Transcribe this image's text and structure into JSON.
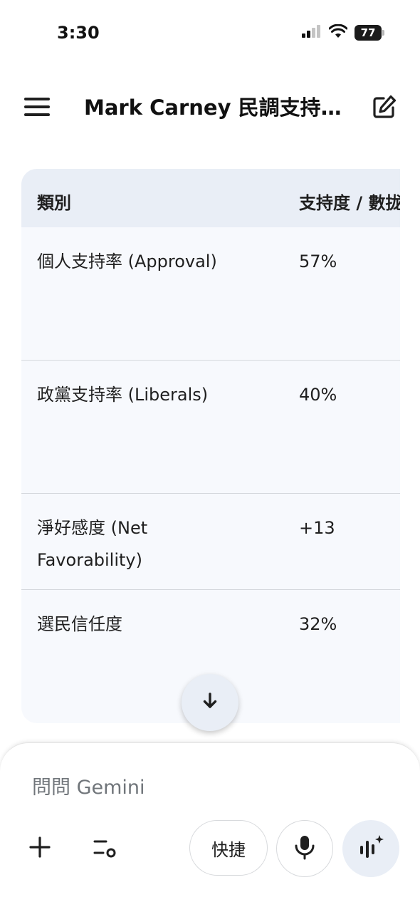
{
  "status_bar": {
    "time": "3:30",
    "battery_level": "77",
    "icons": [
      "signal-icon",
      "wifi-icon",
      "battery-icon"
    ]
  },
  "header": {
    "title": "Mark Carney 民調支持…",
    "menu_icon": "menu-icon",
    "edit_icon": "edit-icon"
  },
  "table": {
    "columns": [
      "類別",
      "支持度 / 數拢"
    ],
    "rows": [
      {
        "category": "個人支持率 (Approval)",
        "value": "57%"
      },
      {
        "category": "政黨支持率 (Liberals)",
        "value": "40%"
      },
      {
        "category": "淨好感度 (Net Favorability)",
        "value": "+13"
      },
      {
        "category": "選民信任度",
        "value": "32%"
      }
    ]
  },
  "scroll_button": {
    "icon": "arrow-down-icon"
  },
  "composer": {
    "placeholder": "問問 Gemini",
    "shortcut_label": "快捷",
    "icons": [
      "plus-icon",
      "tools-icon",
      "mic-icon",
      "live-icon"
    ]
  },
  "colors": {
    "table_header_bg": "#e9eef6",
    "table_body_bg": "#f7f9fd",
    "text": "#1f1f1f",
    "placeholder": "#70757a"
  }
}
